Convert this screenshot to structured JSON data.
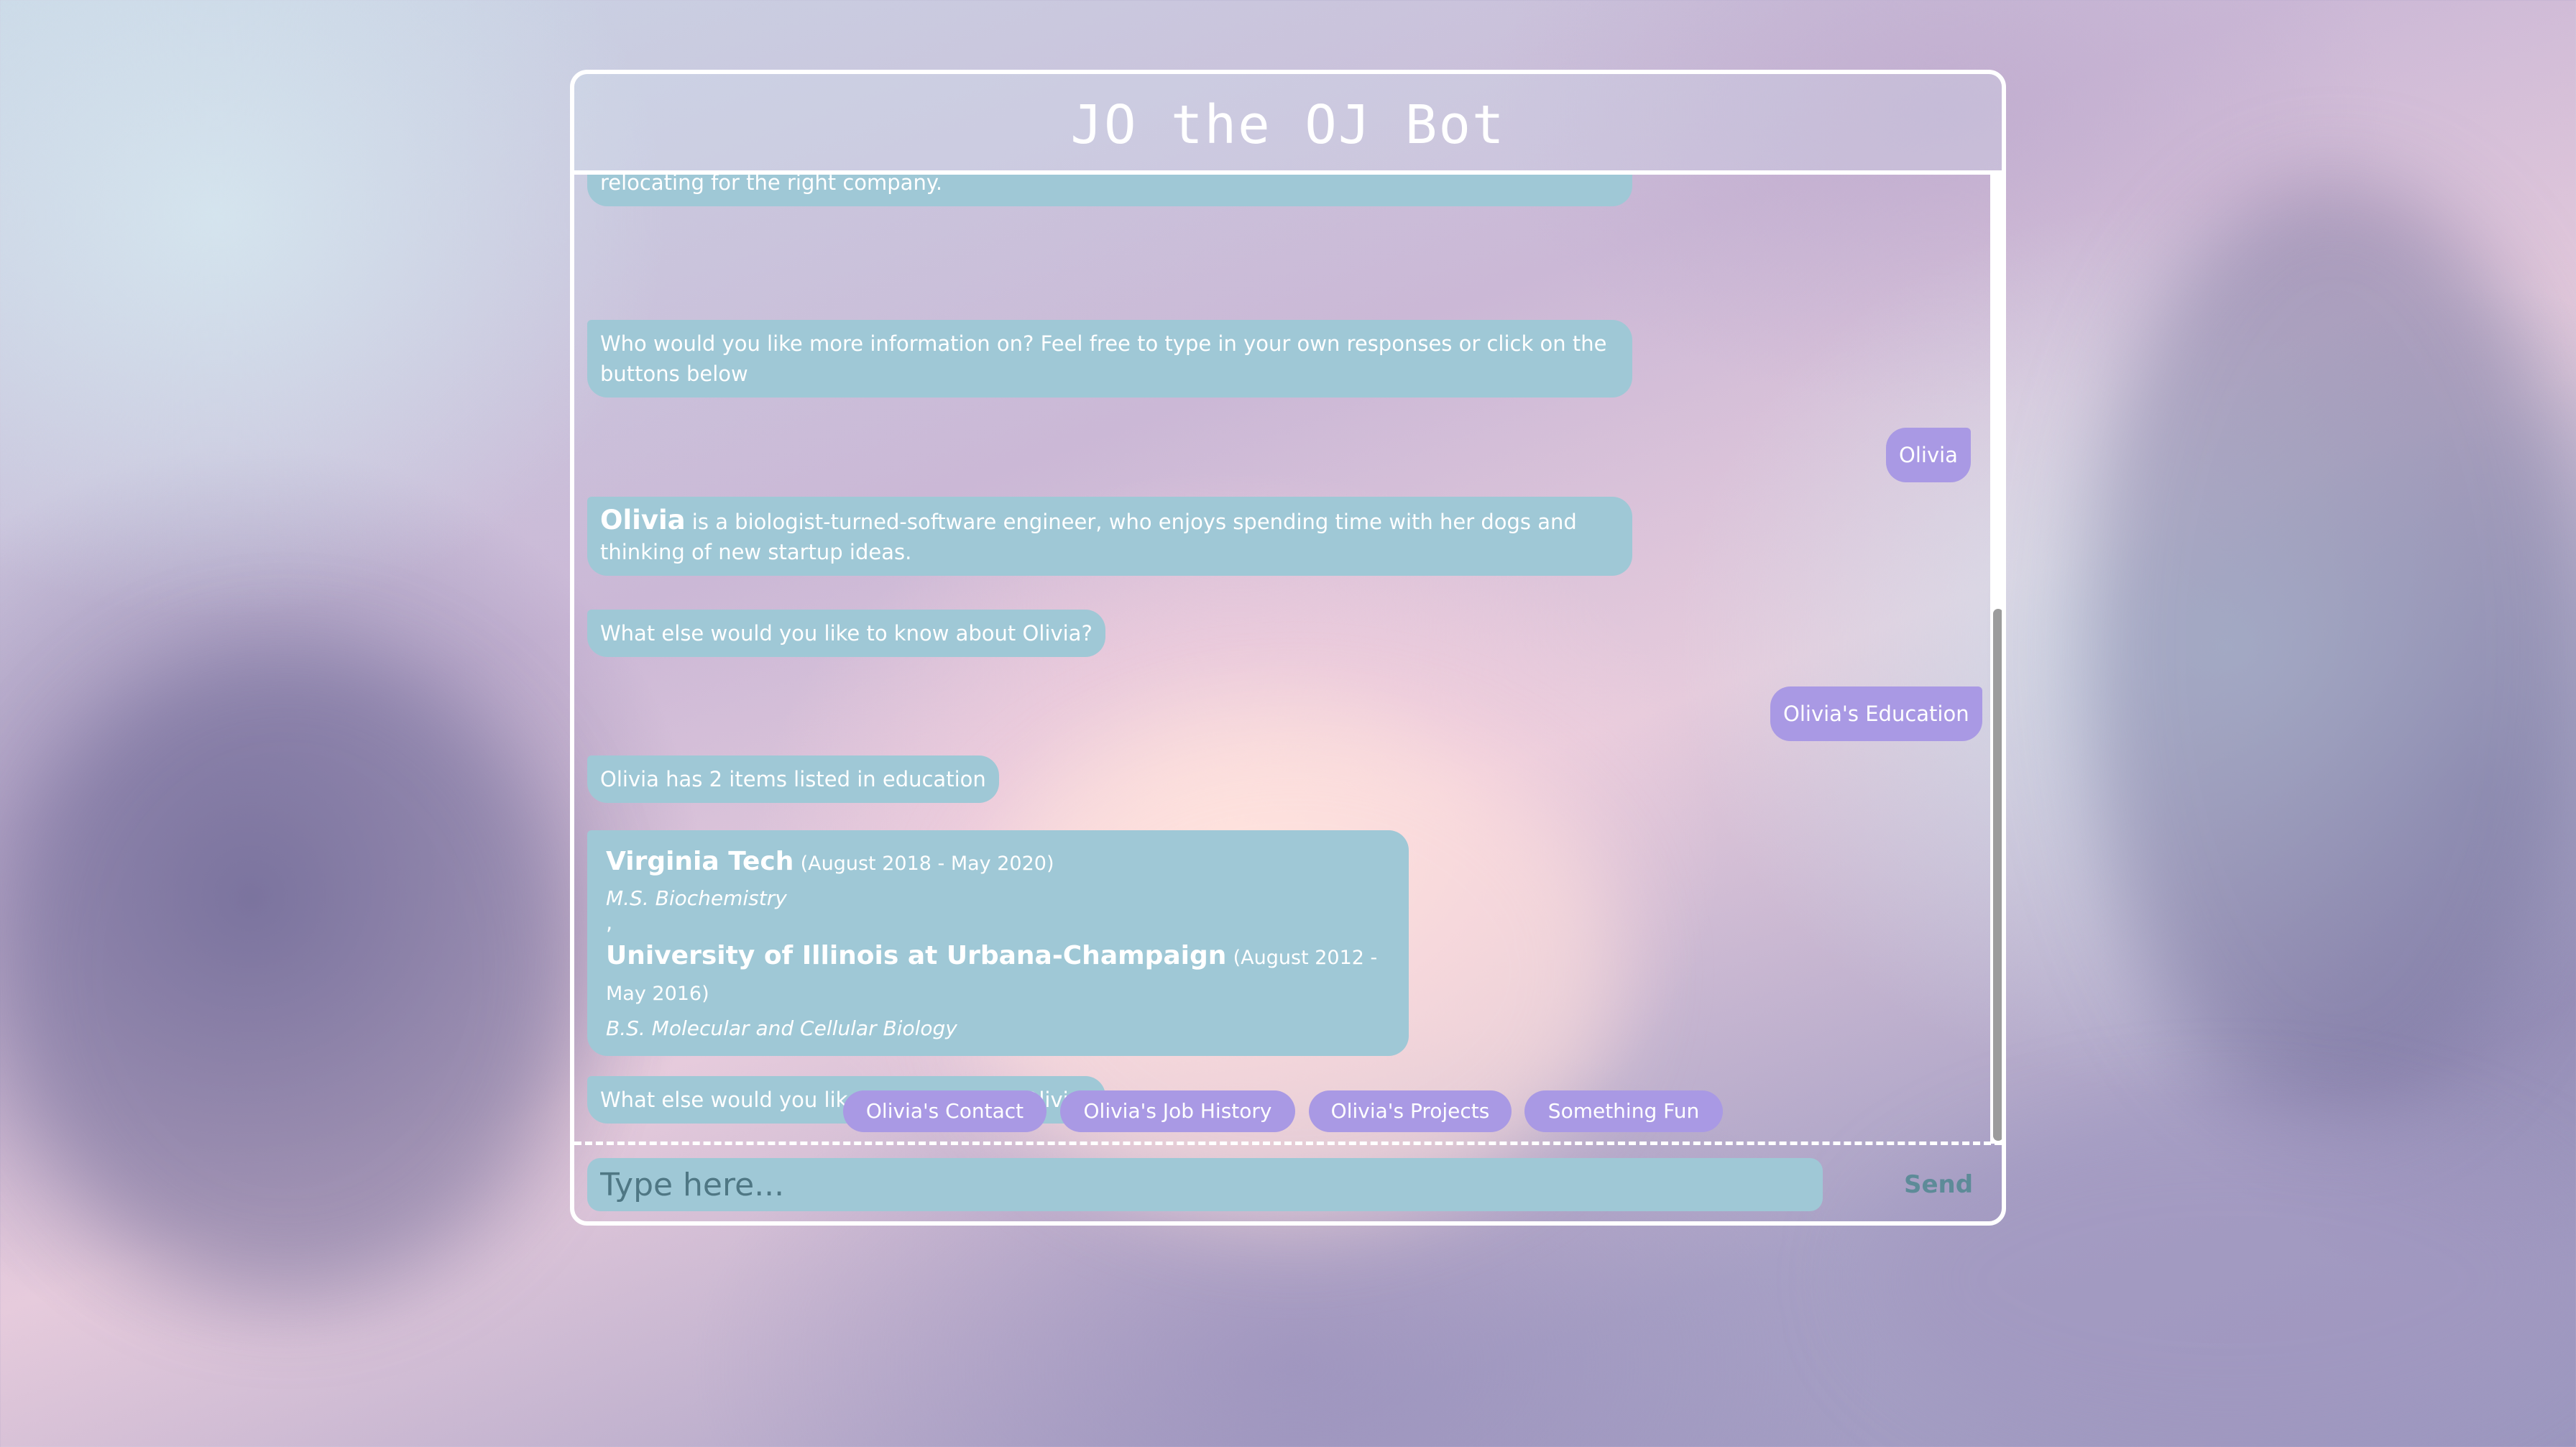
{
  "header": {
    "title": "JO the OJ Bot"
  },
  "messages": {
    "m1": "Jon and Olivia are both open to job opportunities at the moment. They are also both open to relocating for the right company.",
    "m2": "Who would you like more information on? Feel free to type in your own responses or click on the buttons below",
    "u1": "Olivia",
    "m3_name": "Olivia",
    "m3_text": " is a biologist-turned-software engineer, who enjoys spending time with her dogs and thinking of new startup ideas.",
    "m4": "What else would you like to know about Olivia?",
    "u2": "Olivia's Education",
    "m5": "Olivia has 2 items listed in education",
    "education": [
      {
        "school": "Virginia Tech",
        "dates": "(August 2018 - May 2020)",
        "degree": "M.S. Biochemistry"
      },
      {
        "school": "University of Illinois at Urbana-Champaign",
        "dates": "(August 2012 - May 2016)",
        "degree": "B.S. Molecular and Cellular Biology"
      }
    ],
    "separator": ",",
    "m6": "What else would you like to know about Olivia?"
  },
  "quick_replies": [
    "Olivia's Contact",
    "Olivia's Job History",
    "Olivia's Projects",
    "Something Fun"
  ],
  "input": {
    "placeholder": "Type here...",
    "value": ""
  },
  "send_label": "Send",
  "colors": {
    "bot_bubble": "#9fc8d6",
    "user_bubble": "#a999e4",
    "border": "#ffffff"
  }
}
